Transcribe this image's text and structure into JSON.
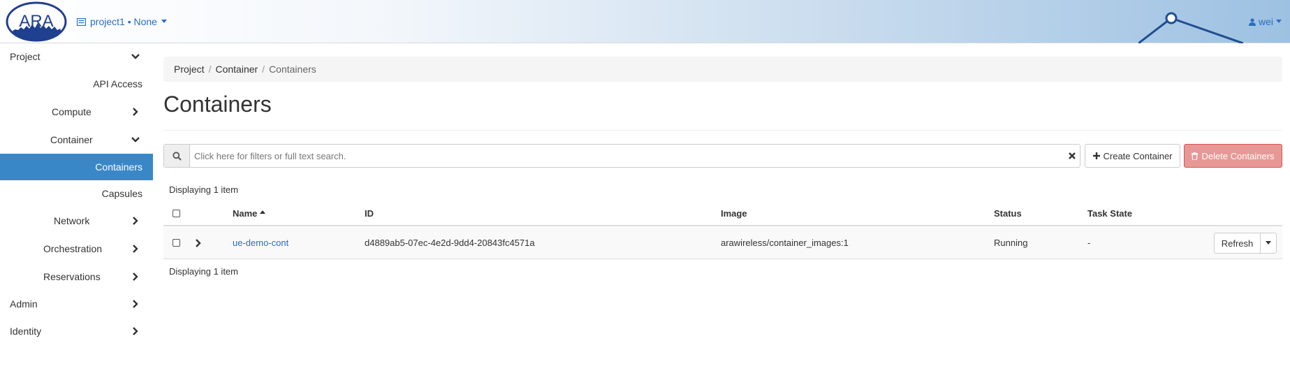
{
  "header": {
    "logo_text": "ARA",
    "project_label": "project1 • None",
    "user_label": "wei"
  },
  "sidebar": {
    "items": [
      {
        "label": "Project",
        "level": 0,
        "chevron": "down"
      },
      {
        "label": "API Access",
        "level": 2,
        "chevron": "none"
      },
      {
        "label": "Compute",
        "level": 1,
        "chevron": "right"
      },
      {
        "label": "Container",
        "level": 1,
        "chevron": "down"
      },
      {
        "label": "Containers",
        "level": 2,
        "chevron": "none",
        "active": true
      },
      {
        "label": "Capsules",
        "level": 2,
        "chevron": "none"
      },
      {
        "label": "Network",
        "level": 1,
        "chevron": "right"
      },
      {
        "label": "Orchestration",
        "level": 1,
        "chevron": "right"
      },
      {
        "label": "Reservations",
        "level": 1,
        "chevron": "right"
      },
      {
        "label": "Admin",
        "level": 0,
        "chevron": "right"
      },
      {
        "label": "Identity",
        "level": 0,
        "chevron": "right"
      }
    ]
  },
  "breadcrumb": [
    "Project",
    "Container",
    "Containers"
  ],
  "page_title": "Containers",
  "search": {
    "placeholder": "Click here for filters or full text search.",
    "value": ""
  },
  "actions": {
    "create_label": "Create Container",
    "delete_label": "Delete Containers"
  },
  "table": {
    "count_top": "Displaying 1 item",
    "count_bottom": "Displaying 1 item",
    "columns": {
      "name": "Name",
      "id": "ID",
      "image": "Image",
      "status": "Status",
      "task_state": "Task State"
    },
    "rows": [
      {
        "name": "ue-demo-cont",
        "id": "d4889ab5-07ec-4e2d-9dd4-20843fc4571a",
        "image": "arawireless/container_images:1",
        "status": "Running",
        "task_state": "-",
        "action_label": "Refresh"
      }
    ]
  },
  "colors": {
    "accent": "#3a87c8",
    "link": "#2a6dbf",
    "danger_disabled": "#e79896"
  }
}
